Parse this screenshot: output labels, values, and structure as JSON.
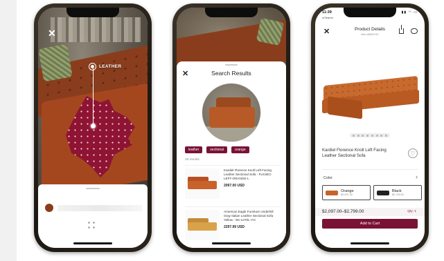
{
  "ar_view": {
    "tag_label": "LEATHER",
    "close_glyph": "✕"
  },
  "search_view": {
    "title": "Search Results",
    "close_glyph": "✕",
    "chips": [
      "leather",
      "sectional",
      "orange"
    ],
    "result_count": "25 results",
    "results": [
      {
        "name": "Kardiel Florence Knoll Left Facing Leather Sectional Sofa - FLKSEC-LEFT-ORANGE-L",
        "price": "2097.00 USD",
        "color": "#c9622a"
      },
      {
        "name": "American Eagle Furniture Underhill Gray Italian Leather Sectional Sofa Yellow - EK-L070L-YO",
        "price": "2297.99 USD",
        "color": "#d9a24a"
      }
    ]
  },
  "details_view": {
    "time": "11:39",
    "back_label": "◂ Search",
    "title": "Product Details",
    "item_number": "Item #8400742",
    "product_name": "Kardiel Florence Knoll Left Facing Leather Sectional Sofa",
    "color_label": "Color",
    "swatches": [
      {
        "name": "Orange",
        "price": "$2,097.00",
        "color": "#c9622a"
      },
      {
        "name": "Black",
        "price": "$2,799.00",
        "color": "#222222"
      }
    ],
    "price_range": "$2,097.00–$2,799.00",
    "qty_label": "Qty: 1",
    "cart_label": "Add to Cart",
    "accent_color": "#7a1236"
  }
}
